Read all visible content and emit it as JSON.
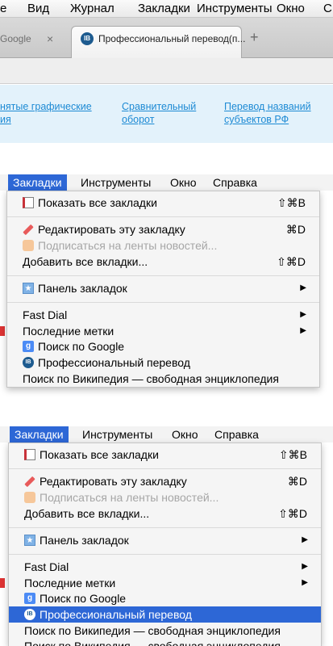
{
  "top_menubar": {
    "items": [
      "е",
      "Вид",
      "Журнал",
      "Закладки",
      "Инструменты",
      "Окно",
      "С"
    ]
  },
  "tabs": {
    "inactive_title": "Google",
    "active_title": "Профессиональный перевод(п...",
    "close_glyph": "×",
    "new_tab_glyph": "+"
  },
  "page": {
    "links": [
      {
        "line1": "нятые графические",
        "line2": "ия"
      },
      {
        "line1": "Сравнительный",
        "line2": "оборот"
      },
      {
        "line1": "Перевод названий",
        "line2": "субъектов РФ"
      }
    ]
  },
  "menubar": {
    "items": [
      "Закладки",
      "Инструменты",
      "Окно",
      "Справка"
    ]
  },
  "bookmarks_menu": {
    "show_all": {
      "label": "Показать все закладки",
      "shortcut": "⇧⌘B"
    },
    "edit": {
      "label": "Редактировать эту закладку",
      "shortcut": "⌘D"
    },
    "subscribe": {
      "label": "Подписаться на ленты новостей..."
    },
    "add_all": {
      "label": "Добавить все вкладки...",
      "shortcut": "⇧⌘D"
    },
    "bar": {
      "label": "Панель закладок",
      "arrow": "▶"
    },
    "fast_dial": {
      "label": "Fast Dial",
      "arrow": "▶"
    },
    "recent_tags": {
      "label": "Последние метки",
      "arrow": "▶"
    },
    "google": {
      "label": "Поиск по Google",
      "icon_text": "g"
    },
    "pro": {
      "label": "Профессиональный перевод",
      "icon_text": "IB"
    },
    "wiki": {
      "label": "Поиск по Википедия — свободная энциклопедия"
    },
    "wiki_dup": {
      "label": "Поиск по Википедия — свободная энциклопедия"
    }
  }
}
